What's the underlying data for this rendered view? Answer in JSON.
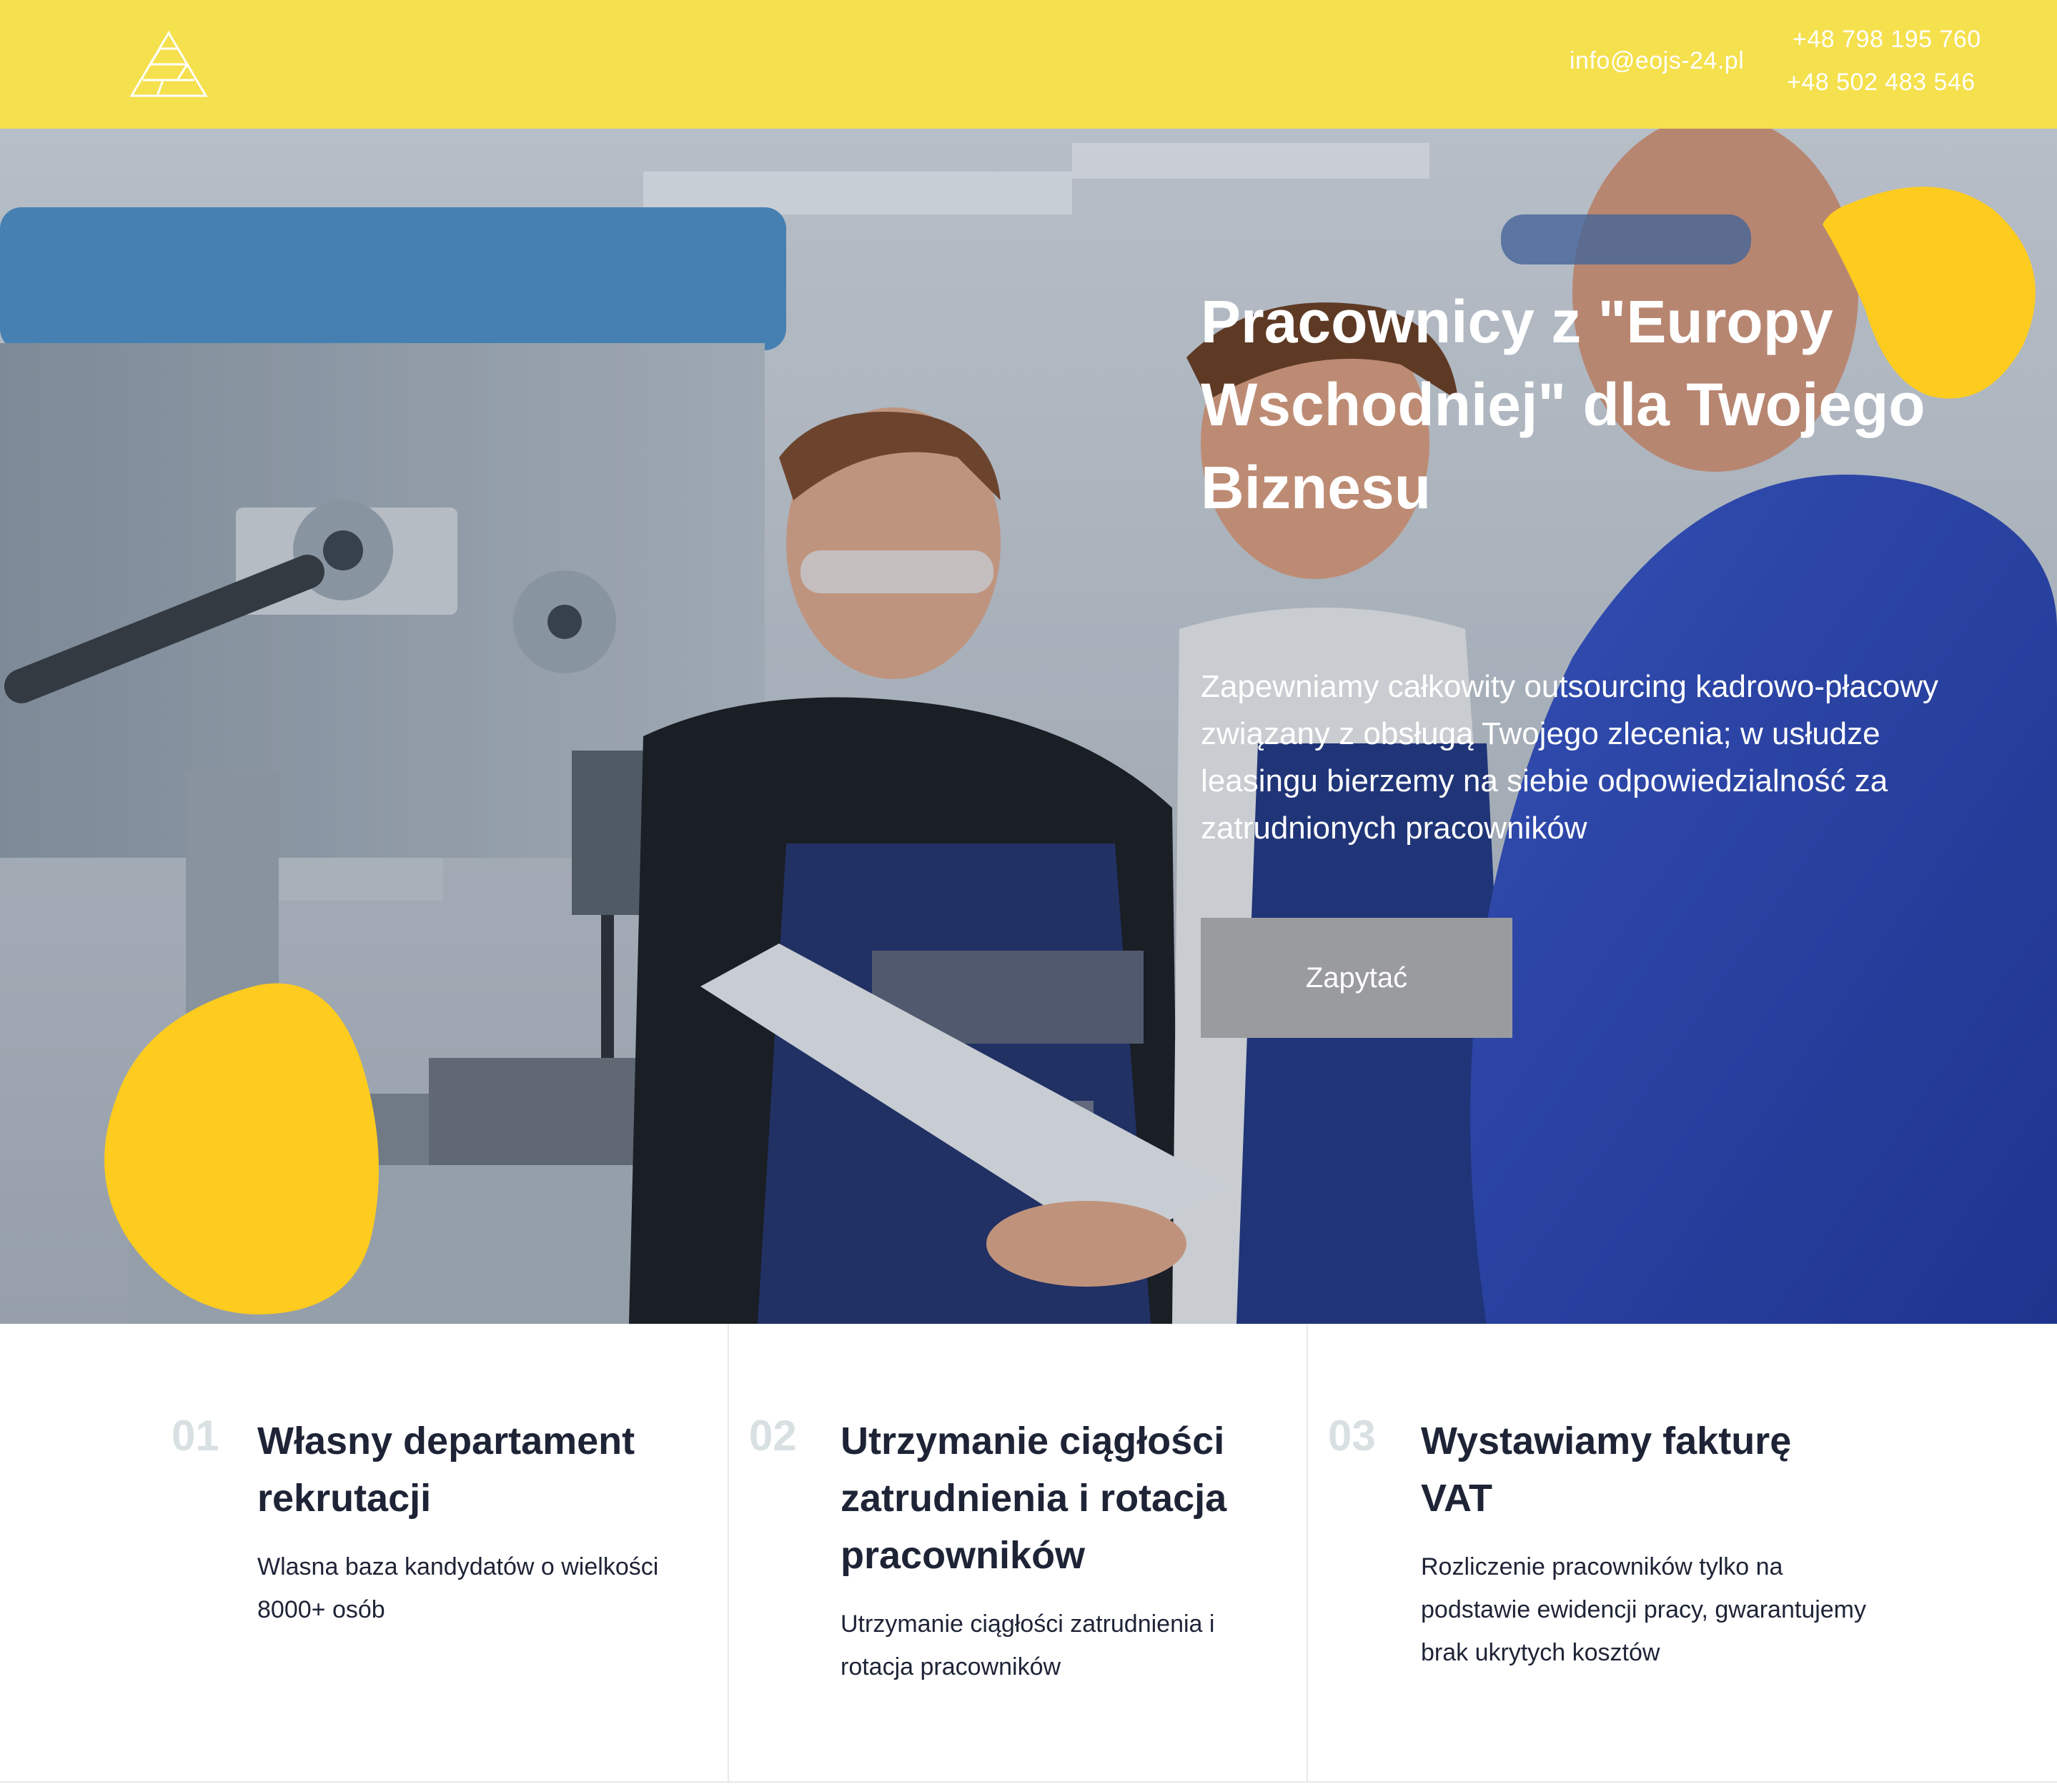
{
  "header": {
    "email": "info@eojs-24.pl",
    "phones": [
      "+48 798 195 760",
      "+48 502 483 546"
    ]
  },
  "hero": {
    "title": "Pracownicy z \"Europy Wschodniej\" dla Twojego Biznesu",
    "description": "Zapewniamy całkowity outsourcing kadrowo-płacowy związany z obsługą Twojego zlecenia; w usłudze leasingu bierzemy na siebie odpowiedzialność za zatrudnionych pracowników",
    "cta_label": "Zapytać"
  },
  "features": [
    {
      "number": "01",
      "title": "Własny departament rekrutacji",
      "text": "Wlasna baza kandydatów o wielkości 8000+ osób"
    },
    {
      "number": "02",
      "title": "Utrzymanie ciągłości zatrudnienia i rotacja pracowników",
      "text": "Utrzymanie ciągłości zatrudnienia i rotacja pracowników"
    },
    {
      "number": "03",
      "title": "Wystawiamy fakturę VAT",
      "text": "Rozliczenie pracowników tylko na podstawie ewidencji pracy, gwarantujemy brak ukrytych kosztów"
    }
  ],
  "colors": {
    "topbar": "#f5e04e",
    "accent_blob": "#fecb1f",
    "cta": "#9a9b9e",
    "text_dark": "#1e2436",
    "number_muted": "#d8e0e2"
  }
}
